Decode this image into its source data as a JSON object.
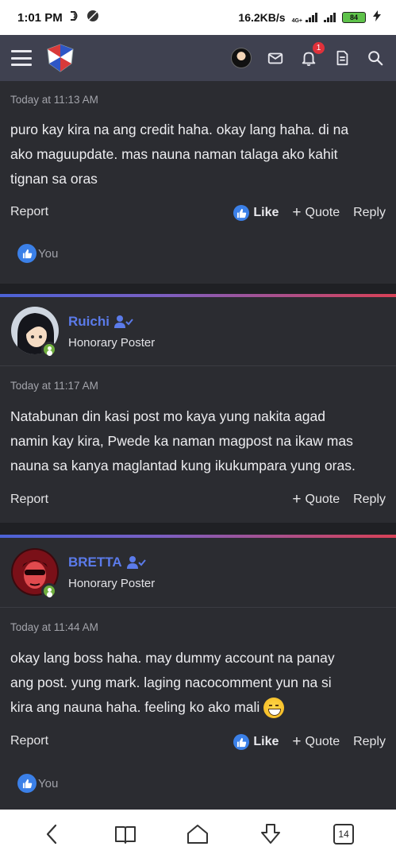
{
  "status_bar": {
    "time": "1:01 PM",
    "network_speed": "16.2KB/s",
    "network_type": "4G+",
    "battery": "84",
    "icons": [
      "dolby-icon",
      "circle-slash-icon",
      "signal-icon",
      "charging-icon"
    ]
  },
  "header": {
    "icons": [
      "menu-icon",
      "site-logo",
      "user-avatar",
      "mail-icon",
      "bell-icon",
      "document-icon",
      "search-icon"
    ],
    "notification_count": "1",
    "accent": "#3f4150"
  },
  "posts": [
    {
      "timestamp": "Today at 11:13 AM",
      "lines": [
        "puro kay kira na ang credit haha. okay lang haha. di na",
        "ako maguupdate. mas nauna naman talaga ako kahit",
        "tignan sa oras"
      ],
      "report_label": "Report",
      "like_label": "Like",
      "quote_label": "Quote",
      "reply_label": "Reply",
      "reaction_label": "You"
    },
    {
      "username": "Ruichi",
      "user_title": "Honorary Poster",
      "timestamp": "Today at 11:17 AM",
      "lines": [
        "Natabunan din kasi post mo kaya yung nakita agad",
        "namin kay kira, Pwede ka naman magpost na ikaw mas",
        "nauna sa kanya maglantad kung ikukumpara yung oras."
      ],
      "report_label": "Report",
      "quote_label": "Quote",
      "reply_label": "Reply"
    },
    {
      "username": "BRETTA",
      "user_title": "Honorary Poster",
      "timestamp": "Today at 11:44 AM",
      "lines": [
        "okay lang boss haha. may dummy account na panay",
        "ang post. yung mark. laging nacocomment yun na si",
        "kira ang nauna haha. feeling ko ako mali"
      ],
      "report_label": "Report",
      "like_label": "Like",
      "quote_label": "Quote",
      "reply_label": "Reply",
      "reaction_label": "You"
    }
  ],
  "bottom_nav": {
    "icons": [
      "back-icon",
      "bookmarks-icon",
      "home-icon",
      "download-icon",
      "tabs-icon"
    ],
    "tab_count": "14"
  },
  "colors": {
    "username": "#5b7bea",
    "like_blue": "#3b80e8",
    "online_green": "#6fae3e",
    "gradient_start": "#4b62d6",
    "gradient_end": "#d84156"
  }
}
